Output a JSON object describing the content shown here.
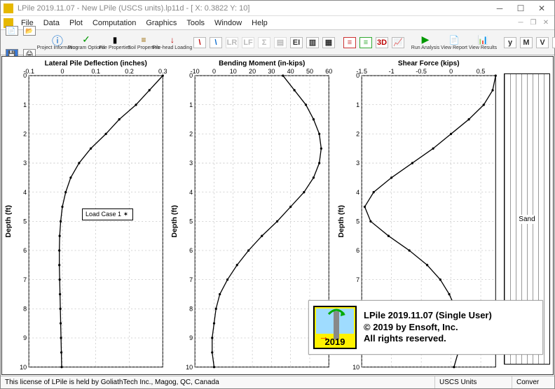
{
  "window": {
    "title": "LPile 2019.11.07 - New LPile (USCS units).lp11d - [ X: 0.3822 Y: 10]"
  },
  "menu": {
    "file": "File",
    "data": "Data",
    "plot": "Plot",
    "computation": "Computation",
    "graphics": "Graphics",
    "tools": "Tools",
    "window": "Window",
    "help": "Help"
  },
  "toolbar": {
    "project_info": "Project\nInformation",
    "program_options": "Program\nOptions",
    "pile_properties": "Pile\nProperties",
    "soil_properties": "Soil\nProperties",
    "pile_head_loading": "Pile-head\nLoading",
    "run_analysis": "Run\nAnalysis",
    "view_report": "View\nReport",
    "view_results": "View\nResults"
  },
  "legend": {
    "label": "Load Case 1"
  },
  "soil": {
    "layer_label": "Sand"
  },
  "about": {
    "title": "LPile 2019.11.07 (Single User)",
    "copyright": "© 2019 by Ensoft, Inc.",
    "rights": "All rights reserved.",
    "year": "2019"
  },
  "statusbar": {
    "license": "This license of LPile is held by GoliathTech Inc., Magog, QC, Canada",
    "units": "USCS Units",
    "mode": "Conver"
  },
  "chart_data": [
    {
      "type": "line",
      "title": "Lateral Pile Deflection (inches)",
      "xlabel_top": "Lateral Pile Deflection (inches)",
      "ylabel": "Depth (ft)",
      "xlim": [
        -0.1,
        0.3
      ],
      "ylim": [
        10,
        0
      ],
      "xticks": [
        -0.1,
        0,
        0.1,
        0.2,
        0.3
      ],
      "yticks": [
        0,
        1,
        2,
        3,
        4,
        5,
        6,
        7,
        8,
        9,
        10
      ],
      "series": [
        {
          "name": "Load Case 1",
          "x": [
            0.3,
            0.26,
            0.22,
            0.17,
            0.13,
            0.085,
            0.05,
            0.025,
            0.01,
            0.0,
            -0.005,
            -0.008,
            -0.009,
            -0.009,
            -0.008,
            -0.007,
            -0.006,
            -0.005,
            -0.004,
            -0.003,
            -0.002
          ],
          "y": [
            0,
            0.5,
            1.0,
            1.5,
            2.0,
            2.5,
            3.0,
            3.5,
            4.0,
            4.5,
            5.0,
            5.5,
            6.0,
            6.5,
            7.0,
            7.5,
            8.0,
            8.5,
            9.0,
            9.5,
            10.0
          ]
        }
      ]
    },
    {
      "type": "line",
      "title": "Bending Moment (in-kips)",
      "xlabel_top": "Bending Moment (in-kips)",
      "ylabel": "Depth (ft)",
      "xlim": [
        -10,
        60
      ],
      "ylim": [
        10,
        0
      ],
      "xticks": [
        -10,
        0,
        10,
        20,
        30,
        40,
        50,
        60
      ],
      "yticks": [
        0,
        1,
        2,
        3,
        4,
        5,
        6,
        7,
        8,
        9,
        10
      ],
      "series": [
        {
          "name": "Load Case 1",
          "x": [
            36,
            42,
            48,
            52,
            55,
            56,
            55,
            52,
            47,
            40,
            33,
            25,
            18,
            12,
            7,
            3,
            1,
            0,
            -1,
            -1,
            0
          ],
          "y": [
            0,
            0.5,
            1.0,
            1.5,
            2.0,
            2.5,
            3.0,
            3.5,
            4.0,
            4.5,
            5.0,
            5.5,
            6.0,
            6.5,
            7.0,
            7.5,
            8.0,
            8.5,
            9.0,
            9.5,
            10.0
          ]
        }
      ]
    },
    {
      "type": "line",
      "title": "Shear Force (kips)",
      "xlabel_top": "Shear Force (kips)",
      "ylabel": "Depth (ft)",
      "xlim": [
        -1.5,
        0.75
      ],
      "ylim": [
        10,
        0
      ],
      "xticks": [
        -1.5,
        -1.0,
        -0.5,
        0,
        0.5
      ],
      "yticks": [
        0,
        1,
        2,
        3,
        4,
        5,
        6,
        7,
        8,
        9,
        10
      ],
      "series": [
        {
          "name": "Load Case 1",
          "x": [
            0.75,
            0.7,
            0.55,
            0.3,
            0.0,
            -0.3,
            -0.65,
            -1.0,
            -1.3,
            -1.45,
            -1.35,
            -1.05,
            -0.7,
            -0.4,
            -0.18,
            -0.03,
            0.08,
            0.13,
            0.15,
            0.12,
            0.05
          ],
          "y": [
            0,
            0.5,
            1.0,
            1.5,
            2.0,
            2.5,
            3.0,
            3.5,
            4.0,
            4.5,
            5.0,
            5.5,
            6.0,
            6.5,
            7.0,
            7.5,
            8.0,
            8.5,
            9.0,
            9.5,
            10.0
          ]
        }
      ]
    }
  ]
}
